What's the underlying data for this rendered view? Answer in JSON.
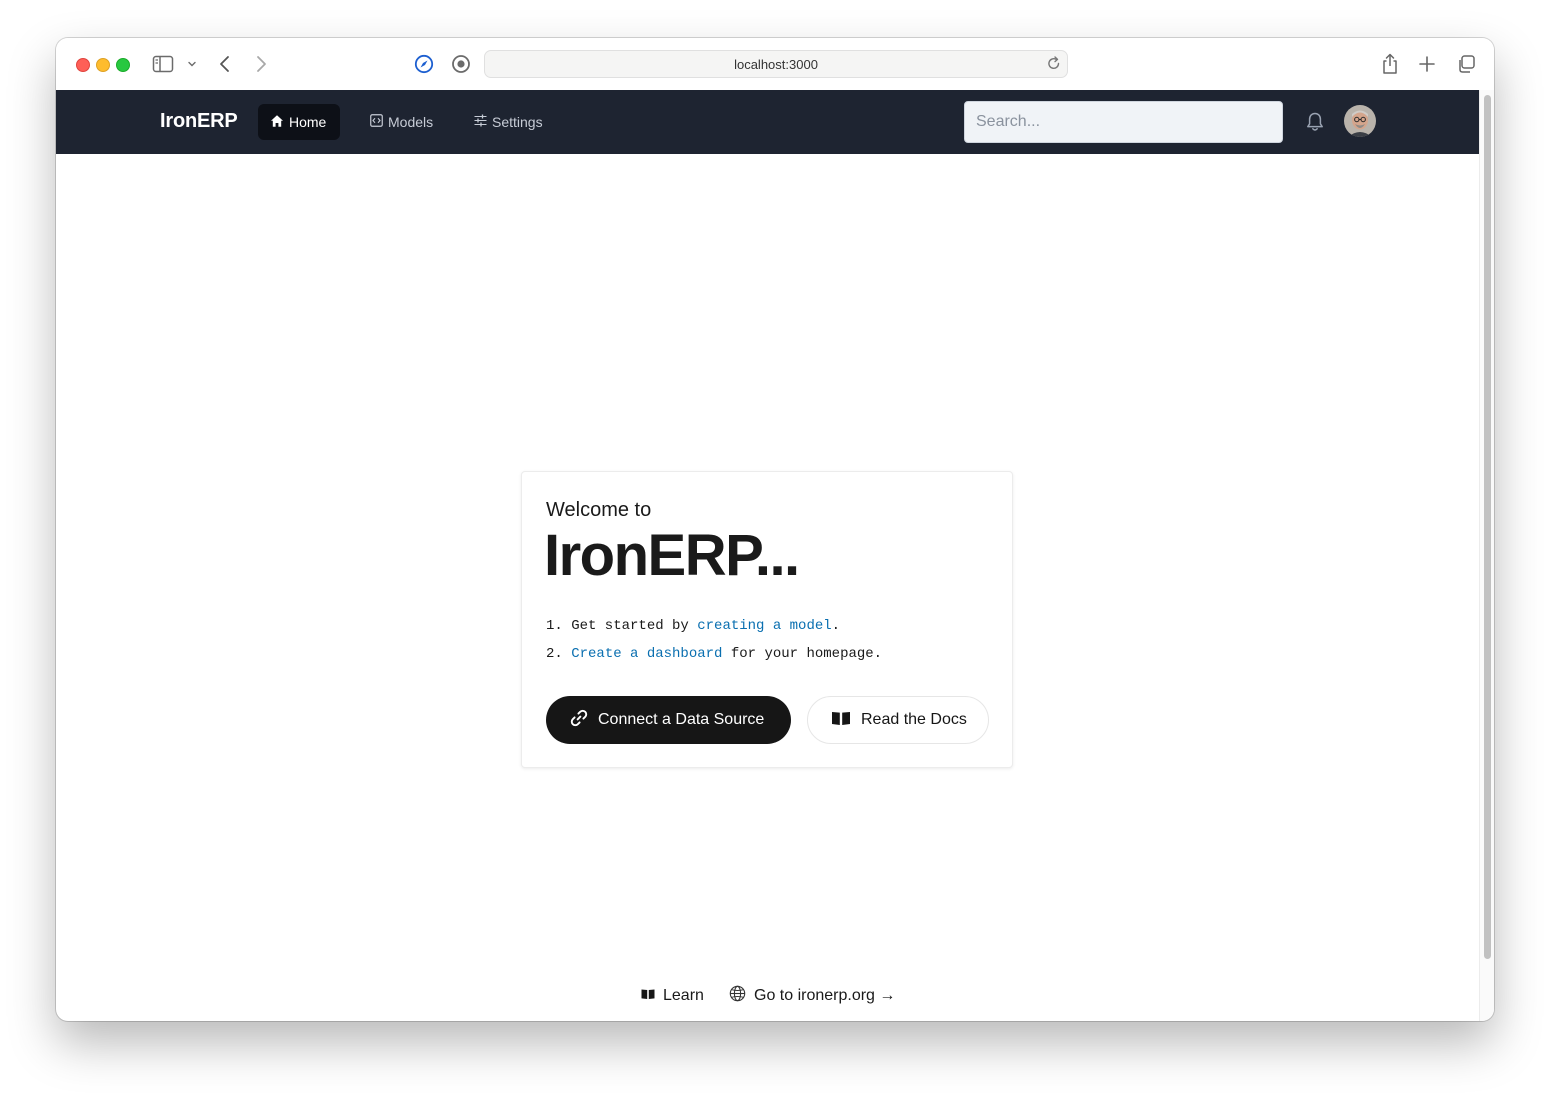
{
  "browser": {
    "url": "localhost:3000"
  },
  "navbar": {
    "brand": "IronERP",
    "items": [
      {
        "label": "Home",
        "icon": "home-icon",
        "active": true
      },
      {
        "label": "Models",
        "icon": "code-icon",
        "active": false
      },
      {
        "label": "Settings",
        "icon": "sliders-icon",
        "active": false
      }
    ],
    "search_placeholder": "Search..."
  },
  "welcome": {
    "intro": "Welcome to",
    "title": "IronERP...",
    "step1_prefix": "1. Get started by ",
    "step1_link": "creating a model",
    "step1_suffix": ".",
    "step2_prefix": "2. ",
    "step2_link": "Create a dashboard",
    "step2_suffix": " for your homepage.",
    "primary_button": "Connect a Data Source",
    "secondary_button": "Read the Docs"
  },
  "footer": {
    "learn": "Learn",
    "site": "Go to ironerp.org →"
  },
  "colors": {
    "navbar_bg": "#1e2431",
    "link": "#0a6fb0",
    "primary_button": "#161616"
  }
}
